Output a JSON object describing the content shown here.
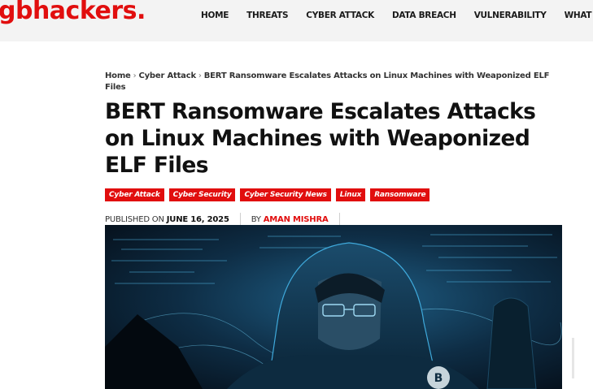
{
  "header": {
    "logo_text": "gbhackers.",
    "nav": [
      "HOME",
      "THREATS",
      "CYBER ATTACK",
      "DATA BREACH",
      "VULNERABILITY",
      "WHAT IS"
    ]
  },
  "breadcrumb": {
    "items": [
      "Home",
      "Cyber Attack",
      "BERT Ransomware Escalates Attacks on Linux Machines with Weaponized ELF Files"
    ]
  },
  "article": {
    "title": "BERT Ransomware Escalates Attacks on Linux Machines with Weaponized ELF Files",
    "categories": [
      "Cyber Attack",
      "Cyber Security",
      "Cyber Security News",
      "Linux",
      "Ransomware"
    ],
    "published_label": "PUBLISHED ON",
    "published_date": "JUNE 16, 2025",
    "by_label": "BY",
    "author": "AMAN MISHRA"
  },
  "colors": {
    "brand": "#e10e0e",
    "header_bg": "#f3f3f3"
  },
  "hero_image": {
    "description_icon": "hooded-hacker-illustration"
  }
}
